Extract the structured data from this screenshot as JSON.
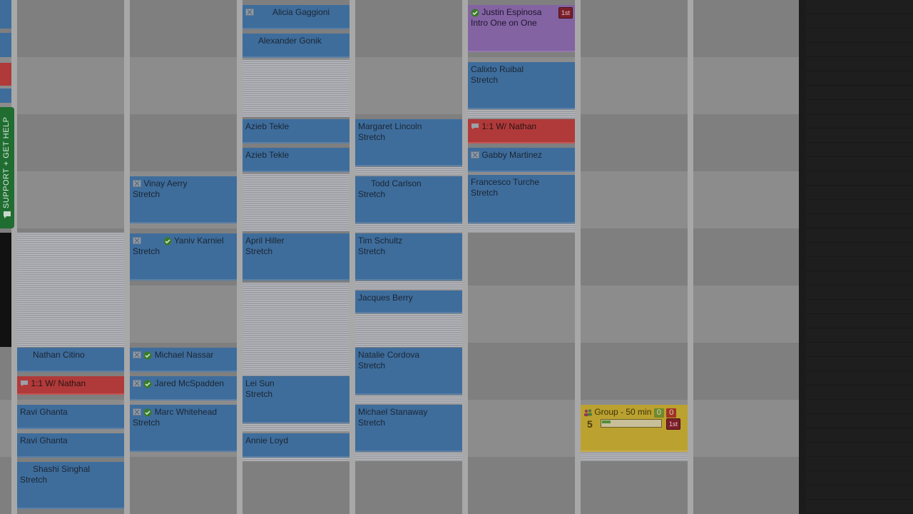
{
  "support_tab": {
    "label": "SUPPORT + GET HELP"
  },
  "columns": [
    {
      "appointments": [
        {
          "name": "Nathan Citino",
          "service": ""
        },
        {
          "name": "1:1 W/ Nathan",
          "service": ""
        },
        {
          "name": "Ravi Ghanta",
          "service": ""
        },
        {
          "name": "Ravi Ghanta",
          "service": ""
        },
        {
          "name": "Shashi Singhal",
          "service": "Stretch"
        }
      ]
    },
    {
      "appointments": [
        {
          "name": "Vinay Aerry",
          "service": "Stretch"
        },
        {
          "name": "Yaniv Karniel",
          "service": "Stretch"
        },
        {
          "name": "Michael Nassar",
          "service": ""
        },
        {
          "name": "Jared McSpadden",
          "service": ""
        },
        {
          "name": "Marc Whitehead",
          "service": "Stretch"
        }
      ]
    },
    {
      "appointments": [
        {
          "name": "Alicia Gaggioni",
          "service": ""
        },
        {
          "name": "Alexander Gonik",
          "service": ""
        },
        {
          "name": "Azieb Tekle",
          "service": ""
        },
        {
          "name": "Azieb Tekle",
          "service": ""
        },
        {
          "name": "April Hiller",
          "service": "Stretch"
        },
        {
          "name": "Lei Sun",
          "service": "Stretch"
        },
        {
          "name": "Annie Loyd",
          "service": ""
        }
      ]
    },
    {
      "appointments": [
        {
          "name": "Margaret Lincoln",
          "service": "Stretch"
        },
        {
          "name": "Todd Carlson",
          "service": "Stretch"
        },
        {
          "name": "Tim Schultz",
          "service": "Stretch"
        },
        {
          "name": "Jacques Berry",
          "service": ""
        },
        {
          "name": "Natalie Cordova",
          "service": "Stretch"
        },
        {
          "name": "Michael Stanaway",
          "service": "Stretch"
        }
      ]
    },
    {
      "appointments": [
        {
          "name": "Justin Espinosa",
          "service": "Intro One on One",
          "badge": "1st"
        },
        {
          "name": "Calixto Ruibal",
          "service": "Stretch"
        },
        {
          "name": "1:1 W/ Nathan",
          "service": ""
        },
        {
          "name": "Gabby Martinez",
          "service": ""
        },
        {
          "name": "Francesco Turche",
          "service": "Stretch"
        }
      ]
    },
    {
      "appointments": [
        {
          "name": "Group - 50 min",
          "count_green": "0",
          "count_red": "0",
          "capacity": "5",
          "badge": "1st",
          "fill_fraction": 0.15
        }
      ]
    }
  ],
  "colors": {
    "appointment": "#3e6d9c",
    "note_block": "#b03a3a",
    "intro": "#8363a2",
    "group_class": "#bba12f",
    "support_tab": "#1f6d30"
  }
}
